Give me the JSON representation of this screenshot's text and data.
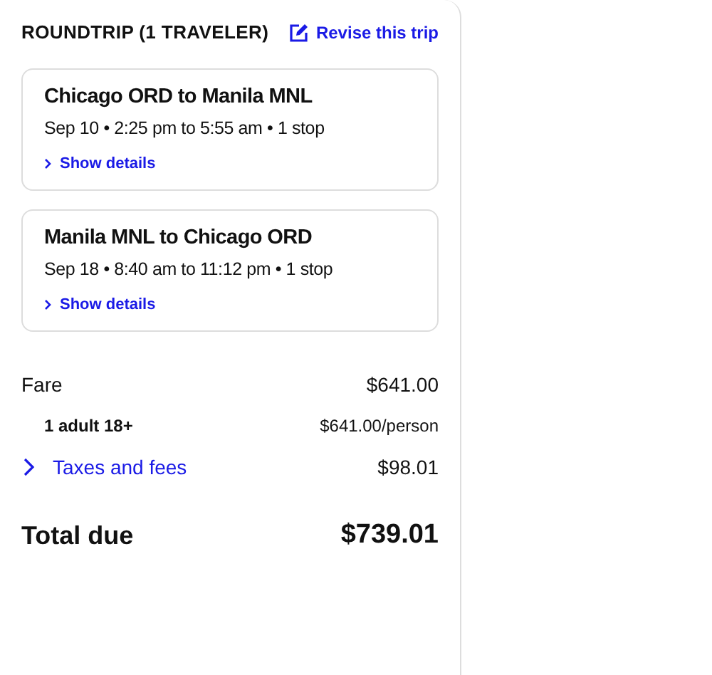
{
  "header": {
    "title": "ROUNDTRIP (1 TRAVELER)",
    "revise_link": "Revise this trip"
  },
  "flights": [
    {
      "route": "Chicago ORD to Manila MNL",
      "schedule": "Sep 10 • 2:25 pm to 5:55 am • 1 stop",
      "details_link": "Show details"
    },
    {
      "route": "Manila MNL to Chicago ORD",
      "schedule": "Sep 18 • 8:40 am to 11:12 pm • 1 stop",
      "details_link": "Show details"
    }
  ],
  "price_rows": [
    {
      "kind": "main",
      "label": "Fare",
      "amount": "$641.00"
    },
    {
      "kind": "sub",
      "label": "1 adult 18+",
      "amount": "$641.00/person"
    },
    {
      "kind": "expand",
      "label": "Taxes and fees",
      "amount": "$98.01"
    }
  ],
  "total": {
    "label": "Total due",
    "amount": "$739.01"
  }
}
